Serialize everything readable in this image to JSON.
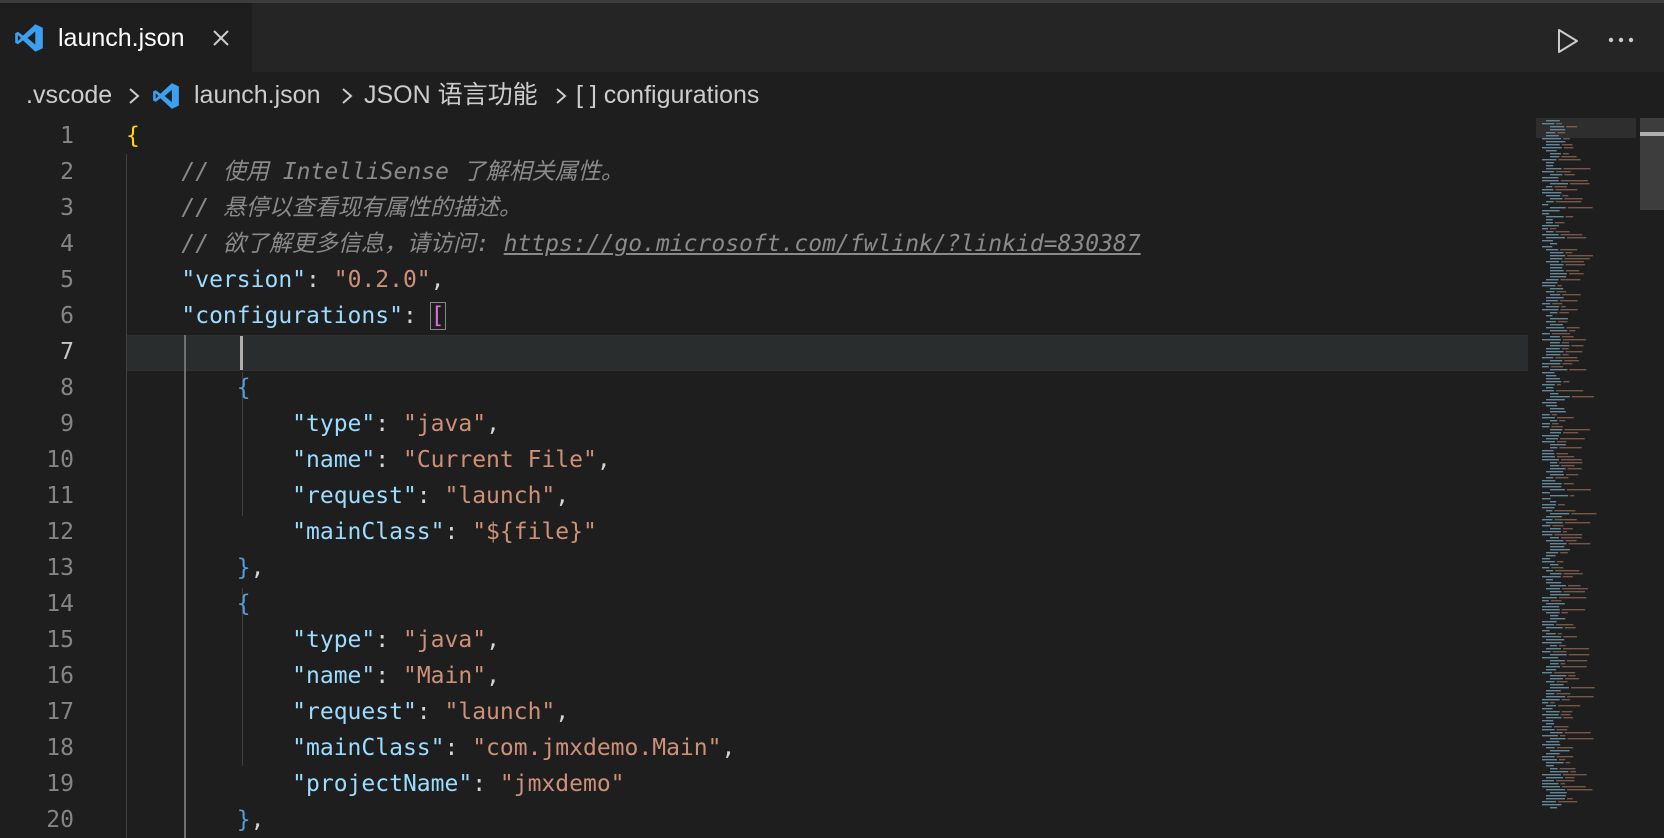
{
  "tab": {
    "label": "launch.json"
  },
  "breadcrumb": [
    {
      "label": ".vscode"
    },
    {
      "label": "launch.json"
    },
    {
      "label": "JSON 语言功能"
    },
    {
      "label": "[ ] configurations"
    }
  ],
  "editor": {
    "current_line": 7,
    "line_numbers": [
      "1",
      "2",
      "3",
      "4",
      "5",
      "6",
      "7",
      "8",
      "9",
      "10",
      "11",
      "12",
      "13",
      "14",
      "15",
      "16",
      "17",
      "18",
      "19",
      "20"
    ],
    "comments": {
      "c2": "// 使用 IntelliSense 了解相关属性。",
      "c3": "// 悬停以查看现有属性的描述。",
      "c4_prefix": "// 欲了解更多信息，请访问: ",
      "c4_url": "https://go.microsoft.com/fwlink/?linkid=830387"
    },
    "keys": {
      "version": "\"version\"",
      "configurations": "\"configurations\"",
      "type": "\"type\"",
      "name": "\"name\"",
      "request": "\"request\"",
      "mainClass": "\"mainClass\"",
      "projectName": "\"projectName\""
    },
    "values": {
      "version": "\"0.2.0\"",
      "java": "\"java\"",
      "current_file": "\"Current File\"",
      "launch": "\"launch\"",
      "file_var": "\"${file}\"",
      "main": "\"Main\"",
      "main_class": "\"com.jmxdemo.Main\"",
      "project": "\"jmxdemo\""
    }
  },
  "colors": {
    "background": "#1e1e1e",
    "tabbar": "#252526",
    "key": "#9cdcfe",
    "string": "#ce9178",
    "comment": "#8a8a8a",
    "brace_outer": "#ffd700",
    "brace_inner": "#569cd6",
    "bracket": "#da70d6",
    "vscode_blue": "#3c9ff0"
  },
  "icons": {
    "file": "vscode-icon",
    "close": "close-icon",
    "run": "run-icon",
    "more": "more-icon",
    "separator": "chevron-right-icon"
  }
}
